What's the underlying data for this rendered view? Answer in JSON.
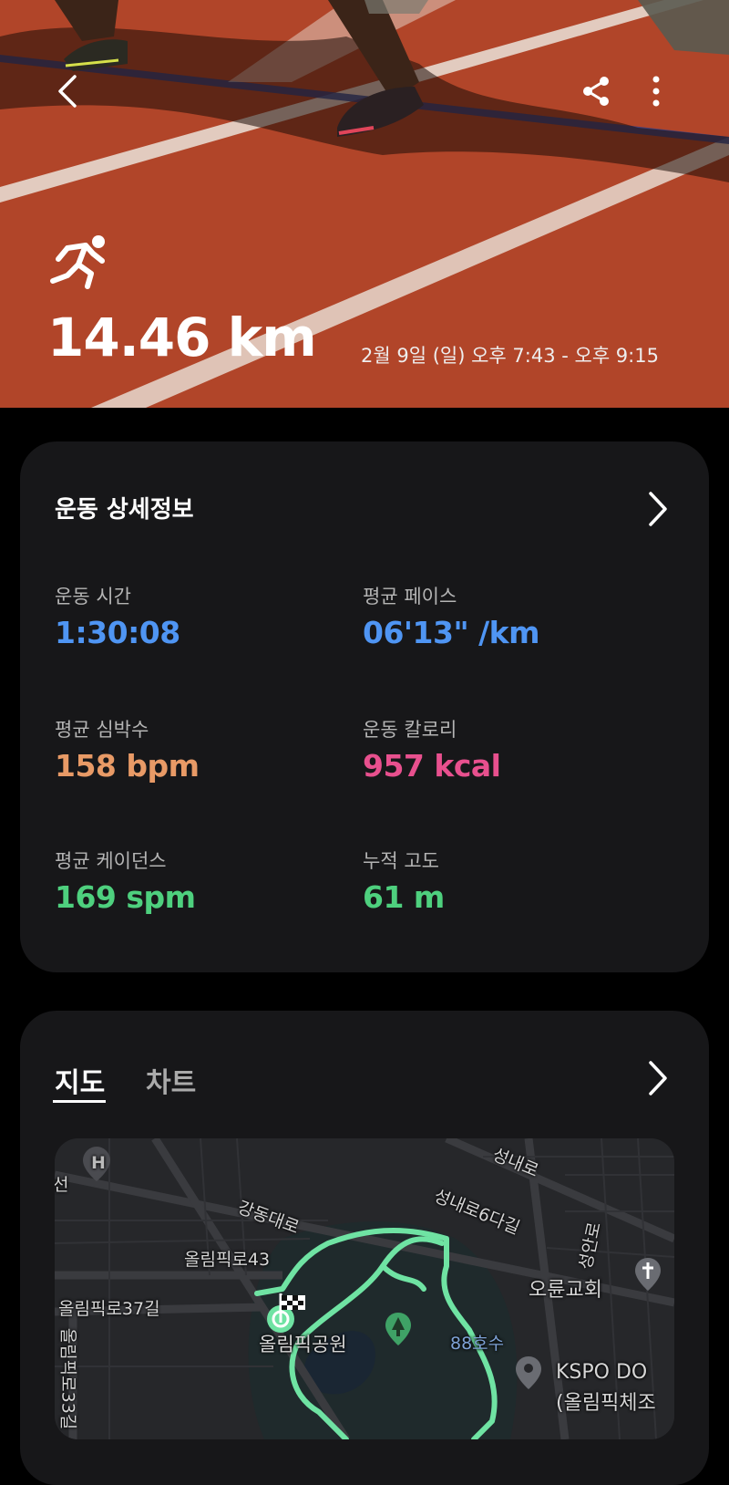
{
  "header": {
    "distance": "14.46 km",
    "time_range": "2월 9일 (일) 오후 7:43 - 오후 9:15",
    "icons": [
      "back-icon",
      "share-icon",
      "more-vert-icon",
      "running-icon"
    ]
  },
  "details": {
    "title": "운동 상세정보",
    "metrics": [
      {
        "label": "운동 시간",
        "value": "1:30:08",
        "color": "#4f95f3"
      },
      {
        "label": "평균 페이스",
        "value": "06'13\" /km",
        "color": "#4f95f3"
      },
      {
        "label": "평균 심박수",
        "value": "158 bpm",
        "color": "#e89a66"
      },
      {
        "label": "운동 칼로리",
        "value": "957 kcal",
        "color": "#e8508e"
      },
      {
        "label": "평균 케이던스",
        "value": "169 spm",
        "color": "#4ed07e"
      },
      {
        "label": "누적 고도",
        "value": "61 m",
        "color": "#4ed07e"
      }
    ]
  },
  "map_card": {
    "tabs": [
      "지도",
      "차트"
    ],
    "active_tab": "지도",
    "route_color": "#6fe3a3",
    "labels": {
      "seongnae": "성내로",
      "gangdong": "강동대로",
      "seongnae6": "성내로6다길",
      "olympic43": "올림픽로43",
      "olympic37": "올림픽로37길",
      "olympic33": "올림픽로33길",
      "park": "올림픽공원",
      "lake": "88호수",
      "church": "오륜교회",
      "kspo1": "KSPO DO",
      "kspo2": "(올림픽체조",
      "seongan": "성안로",
      "seo": "선",
      "hospital": "H"
    }
  }
}
